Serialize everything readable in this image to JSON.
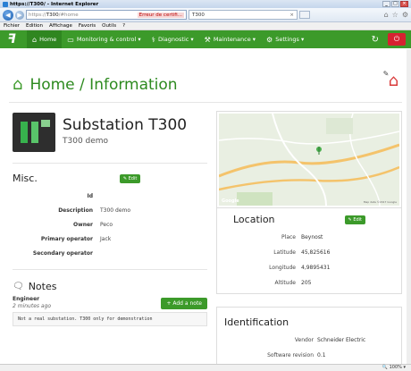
{
  "window": {
    "title": "https://T300/ - Internet Explorer"
  },
  "addressbar": {
    "url_prefix": "https://",
    "url_host": "T300",
    "url_path": "/#home",
    "cert_error": "Erreur de certifi...",
    "tab_title": "T300"
  },
  "ie_menu": [
    "Fichier",
    "Edition",
    "Affichage",
    "Favoris",
    "Outils",
    "?"
  ],
  "navbar": {
    "items": [
      {
        "label": "Home"
      },
      {
        "label": "Monitoring & control ▾"
      },
      {
        "label": "Diagnostic ▾"
      },
      {
        "label": "Maintenance ▾"
      },
      {
        "label": "Settings ▾"
      }
    ]
  },
  "page": {
    "title": "Home / Information"
  },
  "device": {
    "name": "Substation T300",
    "subtitle": "T300 demo"
  },
  "misc": {
    "title": "Misc.",
    "edit_label": "Edit",
    "rows": [
      {
        "k": "Id",
        "v": ""
      },
      {
        "k": "Description",
        "v": "T300 demo"
      },
      {
        "k": "Owner",
        "v": "Peco"
      },
      {
        "k": "Primary operator",
        "v": "Jack"
      },
      {
        "k": "Secondary operator",
        "v": ""
      }
    ]
  },
  "notes": {
    "title": "Notes",
    "add_label": "Add a note",
    "items": [
      {
        "author": "Engineer",
        "time": "2 minutes ago",
        "text": "Not a real substation. T300 only for demonstration"
      }
    ]
  },
  "map": {
    "badge": "Google",
    "credit": "Map data ©2017 Google"
  },
  "location": {
    "title": "Location",
    "edit_label": "Edit",
    "rows": [
      {
        "k": "Place",
        "v": "Beynost"
      },
      {
        "k": "Latitude",
        "v": "45,825616"
      },
      {
        "k": "Longitude",
        "v": "4,9895431"
      },
      {
        "k": "Altitude",
        "v": "205"
      }
    ]
  },
  "identification": {
    "title": "Identification",
    "rows": [
      {
        "k": "Vendor",
        "v": "Schneider Electric"
      },
      {
        "k": "Software revision",
        "v": "0.1"
      }
    ]
  },
  "status": {
    "zoom": "100%"
  },
  "colors": {
    "brand": "#3c9a2a",
    "logout": "#d62230"
  }
}
